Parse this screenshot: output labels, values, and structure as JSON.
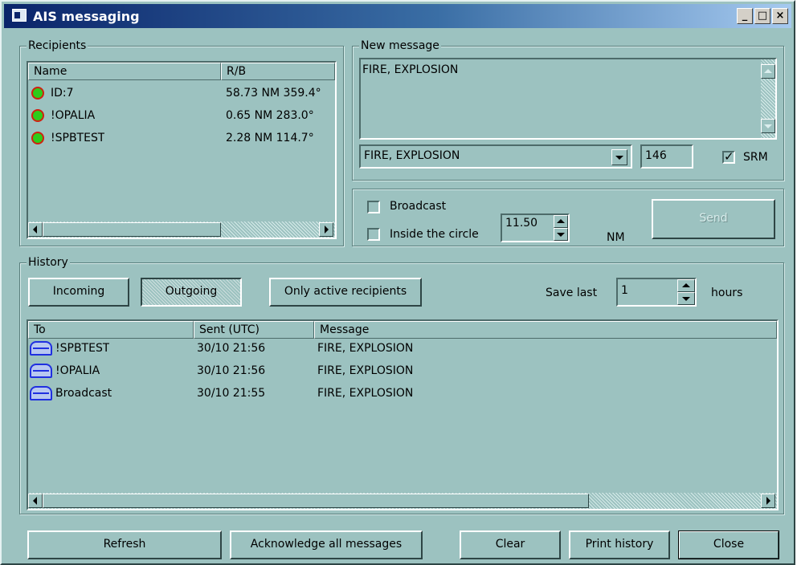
{
  "window": {
    "title": "AIS messaging",
    "minimize_glyph": "_",
    "maximize_glyph": "□",
    "close_glyph": "×"
  },
  "recipients": {
    "group_label": "Recipients",
    "columns": [
      "Name",
      "R/B"
    ],
    "rows": [
      {
        "name": "ID:7",
        "rb": "58.73 NM 359.4°"
      },
      {
        "name": "!OPALIA",
        "rb": "0.65 NM 283.0°"
      },
      {
        "name": "!SPBTEST",
        "rb": "2.28 NM 114.7°"
      }
    ]
  },
  "new_message": {
    "group_label": "New message",
    "text": "FIRE, EXPLOSION",
    "template_selected": "FIRE, EXPLOSION",
    "char_count": "146",
    "srm_label": "SRM",
    "srm_checked": true
  },
  "send_options": {
    "broadcast_label": "Broadcast",
    "broadcast_checked": false,
    "inside_circle_label": "Inside the circle",
    "inside_circle_checked": false,
    "radius_value": "11.50",
    "radius_unit": "NM",
    "send_label": "Send"
  },
  "history": {
    "group_label": "History",
    "incoming_label": "Incoming",
    "outgoing_label": "Outgoing",
    "only_active_label": "Only active recipients",
    "save_last_label": "Save last",
    "save_last_value": "1",
    "hours_label": "hours",
    "columns": [
      "To",
      "Sent (UTC)",
      "Message"
    ],
    "rows": [
      {
        "to": "!SPBTEST",
        "sent": "30/10 21:56",
        "message": "FIRE, EXPLOSION"
      },
      {
        "to": "!OPALIA",
        "sent": "30/10 21:56",
        "message": "FIRE, EXPLOSION"
      },
      {
        "to": "Broadcast",
        "sent": "30/10 21:55",
        "message": "FIRE, EXPLOSION"
      }
    ]
  },
  "footer": {
    "refresh_label": "Refresh",
    "acknowledge_label": "Acknowledge all messages",
    "clear_label": "Clear",
    "print_label": "Print history",
    "close_label": "Close"
  },
  "colors": {
    "window_bg": "#9cc2c0",
    "title_start": "#0a246a",
    "title_end": "#a6caf0",
    "status_green": "#2ecc1a",
    "status_ring": "#d02010",
    "envelope_blue": "#2030e0"
  },
  "icons": {
    "app": "app-window-icon",
    "recipient_status": "vessel-status-icon",
    "outgoing_message": "envelope-icon"
  }
}
